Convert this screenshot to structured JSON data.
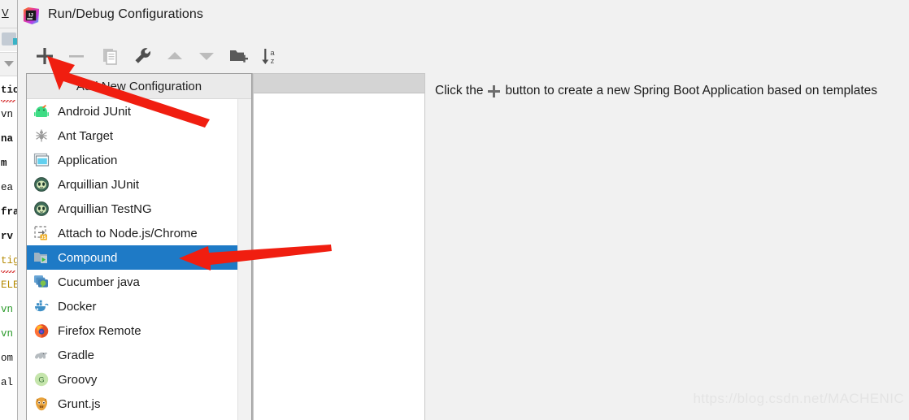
{
  "dialog": {
    "title": "Run/Debug Configurations",
    "logo_icon": "intellij-idea-logo"
  },
  "toolbar": {
    "buttons": [
      {
        "name": "add-configuration-button",
        "icon": "plus-icon",
        "label": "Add New Configuration",
        "enabled": true
      },
      {
        "name": "remove-configuration-button",
        "icon": "minus-icon",
        "label": "Remove Configuration",
        "enabled": false
      },
      {
        "name": "copy-configuration-button",
        "icon": "copy-icon",
        "label": "Copy Configuration",
        "enabled": false
      },
      {
        "name": "edit-templates-button",
        "icon": "wrench-icon",
        "label": "Edit Templates",
        "enabled": true
      },
      {
        "name": "move-up-button",
        "icon": "arrow-up-icon",
        "label": "Move Up",
        "enabled": false
      },
      {
        "name": "move-down-button",
        "icon": "arrow-down-icon",
        "label": "Move Down",
        "enabled": false
      },
      {
        "name": "new-folder-button",
        "icon": "folder-add-icon",
        "label": "Create New Folder",
        "enabled": true
      },
      {
        "name": "sort-button",
        "icon": "sort-az-icon",
        "label": "Sort Configurations",
        "enabled": true
      }
    ]
  },
  "popup": {
    "header": "Add New Configuration",
    "items": [
      {
        "label": "Android JUnit",
        "icon": "android-icon",
        "selected": false,
        "submenu": false
      },
      {
        "label": "Ant Target",
        "icon": "ant-icon",
        "selected": false,
        "submenu": false
      },
      {
        "label": "Application",
        "icon": "application-icon",
        "selected": false,
        "submenu": false
      },
      {
        "label": "Arquillian JUnit",
        "icon": "arquillian-icon",
        "selected": false,
        "submenu": false
      },
      {
        "label": "Arquillian TestNG",
        "icon": "arquillian-icon",
        "selected": false,
        "submenu": false
      },
      {
        "label": "Attach to Node.js/Chrome",
        "icon": "nodejs-attach-icon",
        "selected": false,
        "submenu": false
      },
      {
        "label": "Compound",
        "icon": "compound-icon",
        "selected": true,
        "submenu": false
      },
      {
        "label": "Cucumber java",
        "icon": "cucumber-icon",
        "selected": false,
        "submenu": false
      },
      {
        "label": "Docker",
        "icon": "docker-icon",
        "selected": false,
        "submenu": true
      },
      {
        "label": "Firefox Remote",
        "icon": "firefox-icon",
        "selected": false,
        "submenu": false
      },
      {
        "label": "Gradle",
        "icon": "gradle-icon",
        "selected": false,
        "submenu": false
      },
      {
        "label": "Groovy",
        "icon": "groovy-icon",
        "selected": false,
        "submenu": false
      },
      {
        "label": "Grunt.js",
        "icon": "grunt-icon",
        "selected": false,
        "submenu": false
      }
    ]
  },
  "info_panel": {
    "text_before": "Click the",
    "plus_icon": "plus-icon",
    "text_after": "button to create a new Spring Boot Application based on templates"
  },
  "annotations": {
    "arrow_to_plus": "red-arrow-pointing-to-add-button",
    "arrow_to_compound": "red-arrow-pointing-to-compound-item"
  },
  "watermark": "https://blog.csdn.net/MACHENIC",
  "ide_background": {
    "menu_letter": "V",
    "code_lines": [
      "tio",
      "vn",
      "na",
      "m",
      "ea",
      "fra",
      "rv",
      "tig",
      "ELE",
      "vn",
      "vn",
      "om",
      "al"
    ]
  },
  "colors": {
    "selection_blue": "#1e7ac6",
    "annotation_red": "#f01e10",
    "dialog_bg": "#f1f1f1",
    "panel_header_gray": "#d4d4d4",
    "popup_header_gray": "#eaeaea"
  }
}
